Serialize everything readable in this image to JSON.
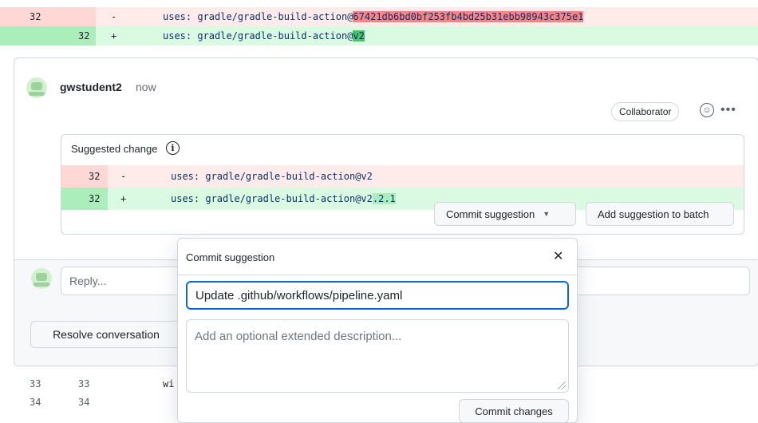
{
  "top_diff": {
    "deleted": {
      "old_line": "32",
      "sign": "-",
      "code_prefix": "uses: gradle/gradle-build-action@",
      "code_highlight": "67421db6bd0bf253fb4bd25b31ebb98943c375e1"
    },
    "added": {
      "new_line": "32",
      "sign": "+",
      "code_prefix": "uses: gradle/gradle-build-action@",
      "code_highlight": "v2"
    }
  },
  "comment": {
    "author": "gwstudent2",
    "time": "now",
    "role_badge": "Collaborator",
    "suggestion_header": "Suggested change",
    "suggestion": {
      "deleted": {
        "line": "32",
        "sign": "-",
        "code": "uses: gradle/gradle-build-action@v2"
      },
      "added": {
        "line": "32",
        "sign": "+",
        "code_prefix": "uses: gradle/gradle-build-action@v2",
        "code_highlight": ".2.1"
      }
    },
    "commit_button": "Commit suggestion",
    "batch_button": "Add suggestion to batch"
  },
  "reply": {
    "placeholder": "Reply..."
  },
  "resolve_button": "Resolve conversation",
  "bottom_lines": [
    {
      "old": "33",
      "new": "33",
      "code": "wi"
    },
    {
      "old": "34",
      "new": "34",
      "code": ""
    }
  ],
  "popover": {
    "title": "Commit suggestion",
    "close_symbol": "✕",
    "commit_message": "Update .github/workflows/pipeline.yaml",
    "description_placeholder": "Add an optional extended description...",
    "commit_button": "Commit changes"
  },
  "colors": {
    "deleted_bg": "#ffebe9",
    "added_bg": "#dafbe1",
    "focus_border": "#0969da"
  }
}
